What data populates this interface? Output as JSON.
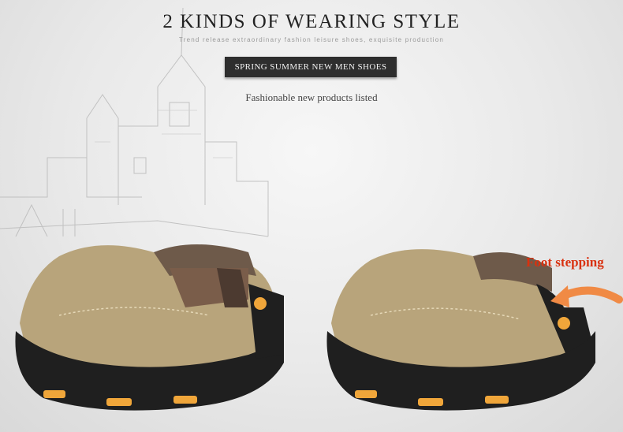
{
  "headline": "2 KINDS OF WEARING STYLE",
  "tagline": "Trend release extraordinary fashion leisure shoes, exquisite production",
  "banner": "SPRING SUMMER NEW MEN SHOES",
  "subtitle": "Fashionable new products listed",
  "annotation": "Foot stepping",
  "colors": {
    "annotation": "#d9310f",
    "arrow": "#f08a45",
    "banner_bg": "#2e2e2e",
    "suede": "#b8a47b",
    "sole": "#1f1f1f",
    "sole_accent": "#f0a63a"
  }
}
